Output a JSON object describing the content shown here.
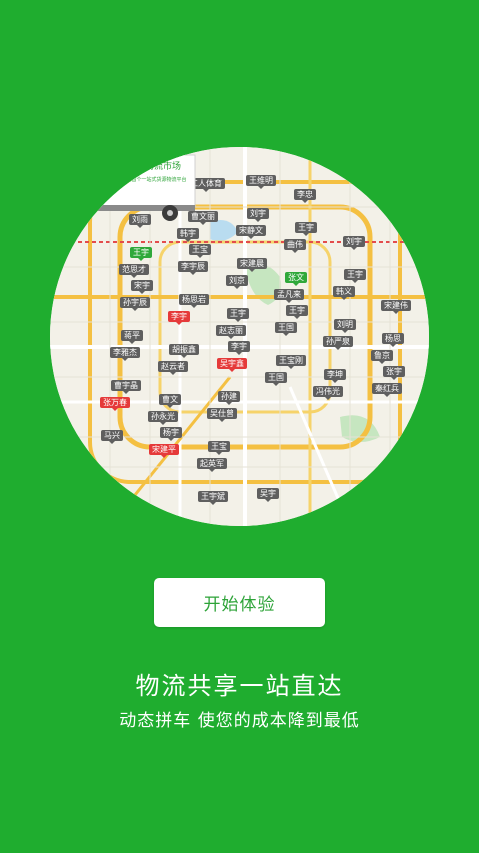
{
  "map": {
    "pins": [
      {
        "label": "韩宇",
        "color": "gray"
      },
      {
        "label": "孟凡来",
        "color": "gray"
      },
      {
        "label": "鲁京",
        "color": "gray"
      },
      {
        "label": "孙永光",
        "color": "gray"
      },
      {
        "label": "范思才",
        "color": "gray"
      },
      {
        "label": "赵志丽",
        "color": "gray"
      },
      {
        "label": "冯伟光",
        "color": "gray"
      },
      {
        "label": "工人体育",
        "color": "gray"
      },
      {
        "label": "曲伟",
        "color": "gray"
      },
      {
        "label": "宋建伟",
        "color": "gray"
      },
      {
        "label": "赵云者",
        "color": "gray"
      },
      {
        "label": "刘雨",
        "color": "gray"
      },
      {
        "label": "刘京",
        "color": "gray"
      },
      {
        "label": "孙严泉",
        "color": "gray"
      },
      {
        "label": "张万春",
        "color": "red"
      },
      {
        "label": "起英军",
        "color": "gray"
      },
      {
        "label": "李忠",
        "color": "gray"
      },
      {
        "label": "李宇",
        "color": "red"
      },
      {
        "label": "王国",
        "color": "gray"
      },
      {
        "label": "宋静文",
        "color": "gray"
      },
      {
        "label": "韩义",
        "color": "gray"
      },
      {
        "label": "李雅杰",
        "color": "gray"
      },
      {
        "label": "吴仕曾",
        "color": "gray"
      },
      {
        "label": "李宇辰",
        "color": "gray"
      },
      {
        "label": "王国",
        "color": "gray"
      },
      {
        "label": "秦红兵",
        "color": "gray"
      },
      {
        "label": "宋建平",
        "color": "red"
      },
      {
        "label": "王维明",
        "color": "gray"
      },
      {
        "label": "刘宇",
        "color": "gray"
      },
      {
        "label": "孙宇辰",
        "color": "gray"
      },
      {
        "label": "吴宇鑫",
        "color": "red"
      },
      {
        "label": "曹文丽",
        "color": "gray"
      },
      {
        "label": "张文",
        "color": "green"
      },
      {
        "label": "杨思",
        "color": "gray"
      },
      {
        "label": "曹文",
        "color": "gray"
      },
      {
        "label": "王宇",
        "color": "green"
      },
      {
        "label": "王宇",
        "color": "gray"
      },
      {
        "label": "李坤",
        "color": "gray"
      },
      {
        "label": "马兴",
        "color": "gray"
      },
      {
        "label": "王宇斌",
        "color": "gray"
      },
      {
        "label": "王宇",
        "color": "gray"
      },
      {
        "label": "胡振鑫",
        "color": "gray"
      },
      {
        "label": "张泉",
        "color": "gray"
      },
      {
        "label": "宋建晨",
        "color": "gray"
      },
      {
        "label": "刘明",
        "color": "gray"
      },
      {
        "label": "曹宇晶",
        "color": "gray"
      },
      {
        "label": "王宝",
        "color": "gray"
      },
      {
        "label": "杨思岩",
        "color": "gray"
      },
      {
        "label": "王宝刚",
        "color": "gray"
      },
      {
        "label": "刘宇",
        "color": "gray"
      },
      {
        "label": "王宇",
        "color": "gray"
      },
      {
        "label": "蒋平",
        "color": "gray"
      },
      {
        "label": "孙建",
        "color": "gray"
      },
      {
        "label": "王宝",
        "color": "gray"
      },
      {
        "label": "王宇",
        "color": "gray"
      },
      {
        "label": "张宇",
        "color": "gray"
      },
      {
        "label": "杨宇",
        "color": "gray"
      },
      {
        "label": "吴宇",
        "color": "gray"
      },
      {
        "label": "宋宇",
        "color": "gray"
      },
      {
        "label": "李宇",
        "color": "gray"
      }
    ],
    "truck_text": "掌上物流市场",
    "truck_logo": "狐",
    "truck_subtext": "全国首个一站式货源物流平台"
  },
  "cta": {
    "start_label": "开始体验"
  },
  "tagline": {
    "title": "物流共享一站直达",
    "subtitle": "动态拼车 使您的成本降到最低"
  },
  "colors": {
    "background": "#1fad2f",
    "button_text": "#2da338",
    "pin_gray": "#5f5f5f",
    "pin_red": "#e53a3a",
    "pin_green": "#2fa83a"
  }
}
